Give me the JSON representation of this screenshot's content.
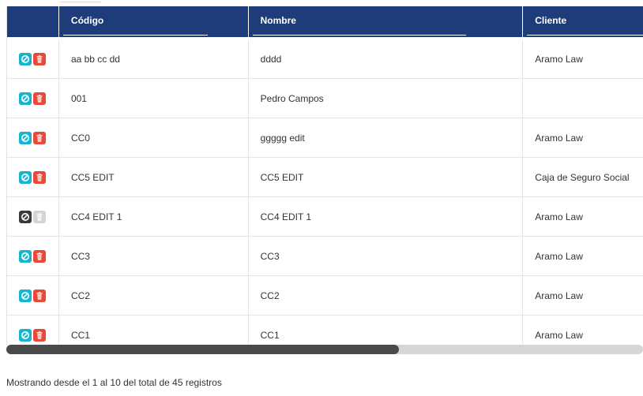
{
  "table": {
    "headers": [
      "",
      "Código",
      "Nombre",
      "Cliente"
    ],
    "rows": [
      {
        "code": "aa bb cc dd",
        "name": "dddd",
        "client": "Aramo Law",
        "active": true
      },
      {
        "code": "001",
        "name": "Pedro Campos",
        "client": "",
        "active": true
      },
      {
        "code": "CC0",
        "name": "ggggg edit",
        "client": "Aramo Law",
        "active": true
      },
      {
        "code": "CC5 EDIT",
        "name": "CC5 EDIT",
        "client": "Caja de Seguro Social",
        "active": true
      },
      {
        "code": "CC4 EDIT 1",
        "name": "CC4 EDIT 1",
        "client": "Aramo Law",
        "active": false
      },
      {
        "code": "CC3",
        "name": "CC3",
        "client": "Aramo Law",
        "active": true
      },
      {
        "code": "CC2",
        "name": "CC2",
        "client": "Aramo Law",
        "active": true
      },
      {
        "code": "CC1",
        "name": "CC1",
        "client": "Aramo Law",
        "active": true
      }
    ],
    "icons": {
      "disable": "ban-icon",
      "delete": "trash-icon"
    }
  },
  "scroll": {
    "horizontal_position": 0
  },
  "footer": {
    "info": "Mostrando desde el 1 al 10 del total de 45 registros"
  },
  "colors": {
    "header_bg": "#1f3c7a",
    "disable_btn": "#17b6cf",
    "delete_btn": "#e84a3a",
    "inactive_disable_btn": "#3a3a3a",
    "inactive_delete_btn": "#d4d4d4"
  }
}
